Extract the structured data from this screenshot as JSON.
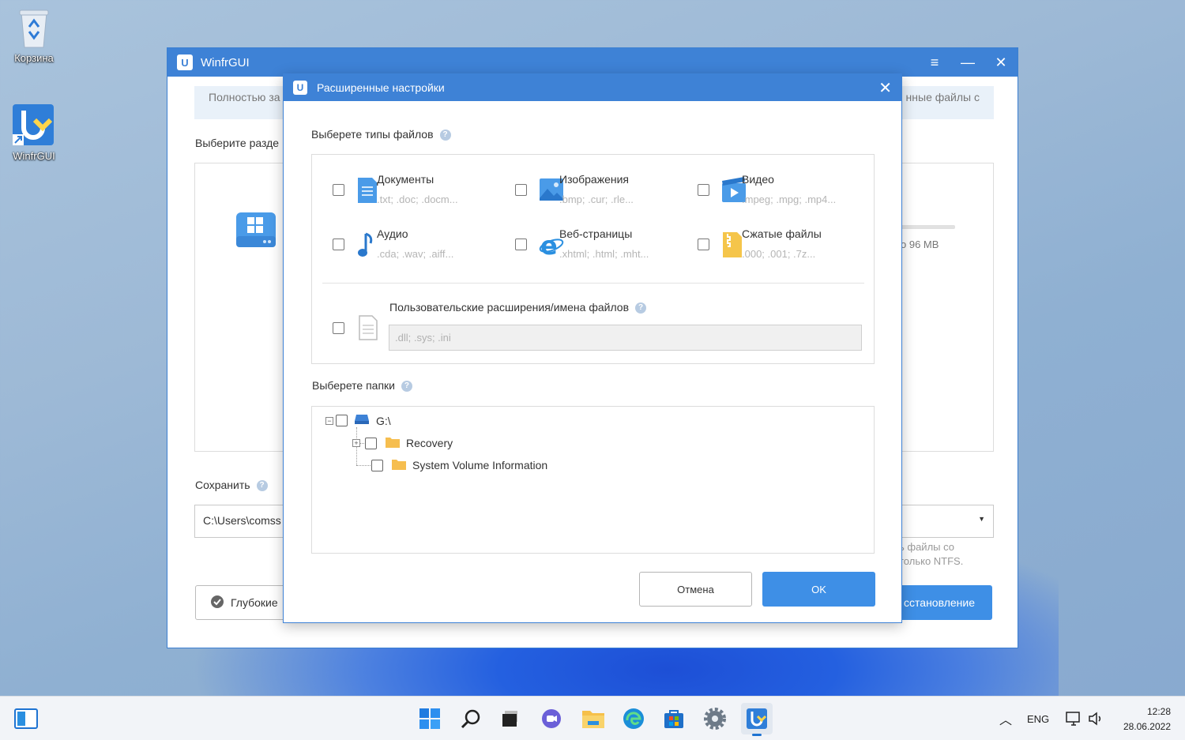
{
  "desktop": {
    "icons": [
      {
        "label": "Корзина",
        "icon": "recycle-bin-icon"
      },
      {
        "label": "WinfrGUI",
        "icon": "winfrgui-icon"
      }
    ]
  },
  "main_window": {
    "title": "WinfrGUI",
    "banner_left": "Полностью за",
    "banner_right": "нные файлы с",
    "select_partition_label": "Выберите разде",
    "partition_size": "о 96 MB",
    "save_label": "Сохранить",
    "save_path": "C:\\Users\\comss",
    "note_line1": "ь файлы со",
    "note_line2": "только NTFS.",
    "deep_button": "Глубокие",
    "recover_button": "сстановление"
  },
  "dialog": {
    "title": "Расширенные настройки",
    "file_types_label": "Выберете типы файлов",
    "file_types": [
      {
        "name": "Документы",
        "ext": ".txt; .doc; .docm...",
        "icon": "document-icon"
      },
      {
        "name": "Изображения",
        "ext": ".bmp; .cur; .rle...",
        "icon": "image-icon"
      },
      {
        "name": "Видео",
        "ext": ".mpeg; .mpg; .mp4...",
        "icon": "video-icon"
      },
      {
        "name": "Аудио",
        "ext": ".cda; .wav; .aiff...",
        "icon": "music-note-icon"
      },
      {
        "name": "Веб-страницы",
        "ext": ".xhtml; .html; .mht...",
        "icon": "web-page-icon"
      },
      {
        "name": "Сжатые файлы",
        "ext": ".000; .001; .7z...",
        "icon": "archive-icon"
      }
    ],
    "custom_label": "Пользовательские расширения/имена файлов",
    "custom_placeholder": ".dll; .sys; .ini",
    "folders_label": "Выберете папки",
    "tree": {
      "root": "G:\\",
      "children": [
        "Recovery",
        "System Volume Information"
      ]
    },
    "cancel_button": "Отмена",
    "ok_button": "OK"
  },
  "taskbar": {
    "language": "ENG",
    "time": "12:28",
    "date": "28.06.2022",
    "pinned": [
      "start-icon",
      "search-icon",
      "task-view-icon",
      "chat-icon",
      "file-explorer-icon",
      "edge-icon",
      "store-icon",
      "settings-icon",
      "winfrgui-icon"
    ]
  },
  "colors": {
    "accent": "#3e82d6",
    "button_primary": "#3e8fe6"
  }
}
